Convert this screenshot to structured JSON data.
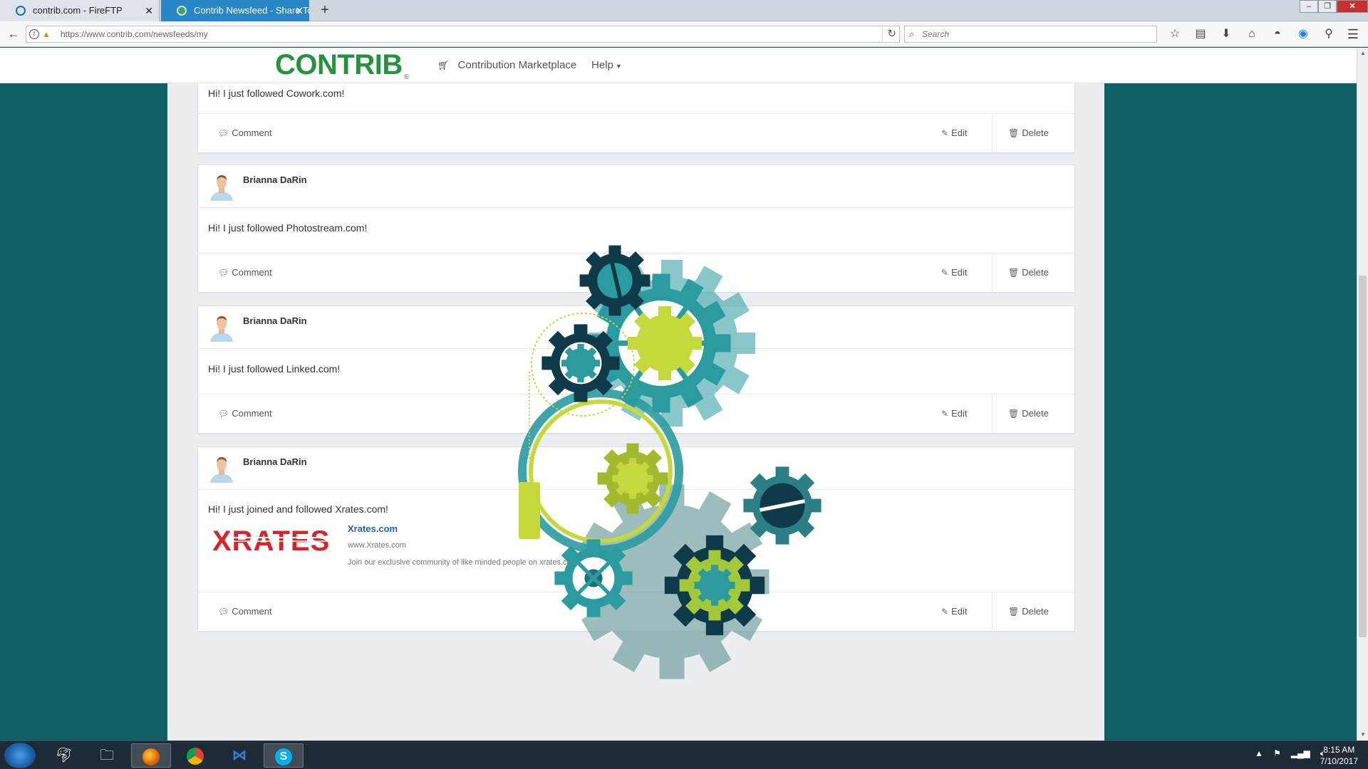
{
  "browser": {
    "tabs": [
      {
        "label": "contrib.com - FireFTP",
        "active": false
      },
      {
        "label": "Contrib Newsfeed - Share To",
        "active": true
      }
    ],
    "url": "https://www.contrib.com/newsfeeds/my",
    "search_placeholder": "Search"
  },
  "site": {
    "logo": "CONTRIB",
    "logo_reg": "®",
    "nav": {
      "marketplace": "Contribution Marketplace",
      "help": "Help"
    }
  },
  "feed": {
    "partial_post_text": "Hi! I just followed Cowork.com!",
    "posts": [
      {
        "author": "Brianna DaRin",
        "text": "Hi! I just followed Photostream.com!"
      },
      {
        "author": "Brianna DaRin",
        "text": "Hi! I just followed Linked.com!"
      },
      {
        "author": "Brianna DaRin",
        "text": "Hi! I just joined and followed Xrates.com!",
        "preview": {
          "logo_text": "XRATES",
          "title": "Xrates.com",
          "url": "www.Xrates.com",
          "description": "Join our exclusive community of like minded people on xrates.com"
        }
      }
    ],
    "actions": {
      "comment": "Comment",
      "edit": "Edit",
      "delete": "Delete"
    }
  },
  "taskbar": {
    "time": "8:15 AM",
    "date": "7/10/2017"
  },
  "colors": {
    "background_teal": "#0e5f62",
    "brand_green": "#26913e",
    "gear_teal": "#2b9ba0",
    "gear_lime": "#c5d83c",
    "gear_dark": "#0f3a4a",
    "link_blue": "#2b5ea8",
    "xrates_red": "#d8232a"
  }
}
